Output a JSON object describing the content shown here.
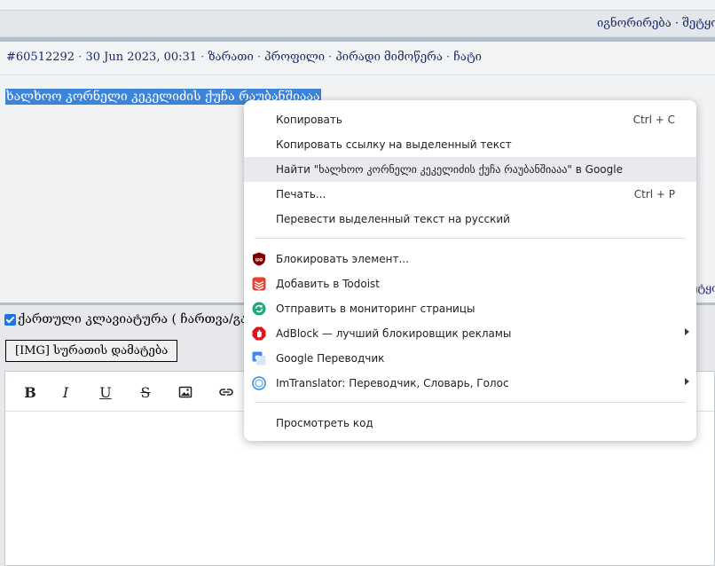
{
  "top_links": {
    "text": "იგნორირება · შეტყო"
  },
  "post": {
    "id": "#60512292",
    "date": "30 Jun 2023, 00:31",
    "links": [
      "ზარათი",
      "პროფილი",
      "პირადი მიმოწერა",
      "ჩატი"
    ],
    "selected_text": "ხალხოო კორნელი კეკელიძის ქუჩა რაუბანშიააა",
    "footer_link": "ეტყო"
  },
  "editor": {
    "keyboard_label": "ქართული კლავიატურა ( ჩართვა/გამო",
    "img_button": "[IMG] სურათის დამატება",
    "toolbar": {
      "bold": "B",
      "italic": "I",
      "underline": "U",
      "strike": "S"
    }
  },
  "context_menu": {
    "items": [
      {
        "label": "Копировать",
        "shortcut": "Ctrl + C"
      },
      {
        "label": "Копировать ссылку на выделенный текст"
      },
      {
        "label": "Найти \"ხალხოო კორნელი კეკელიძის ქუჩა რაუბანშიააა\" в Google"
      },
      {
        "label": "Печать...",
        "shortcut": "Ctrl + P"
      },
      {
        "label": "Перевести выделенный текст на русский"
      },
      {
        "label": "Блокировать элемент...",
        "icon": "ublock-icon"
      },
      {
        "label": "Добавить в Todoist",
        "icon": "todoist-icon"
      },
      {
        "label": "Отправить в мониторинг страницы",
        "icon": "page-monitor-icon"
      },
      {
        "label": "AdBlock — лучший блокировщик рекламы",
        "icon": "adblock-icon"
      },
      {
        "label": "Google Переводчик",
        "icon": "google-translate-icon"
      },
      {
        "label": "ImTranslator: Переводчик, Словарь, Голос",
        "icon": "imtranslator-icon"
      },
      {
        "label": "Просмотреть код"
      }
    ]
  },
  "colors": {
    "selection": "#3b84d9",
    "link": "#1a2a6a",
    "menu_highlight": "#e8eaed"
  }
}
